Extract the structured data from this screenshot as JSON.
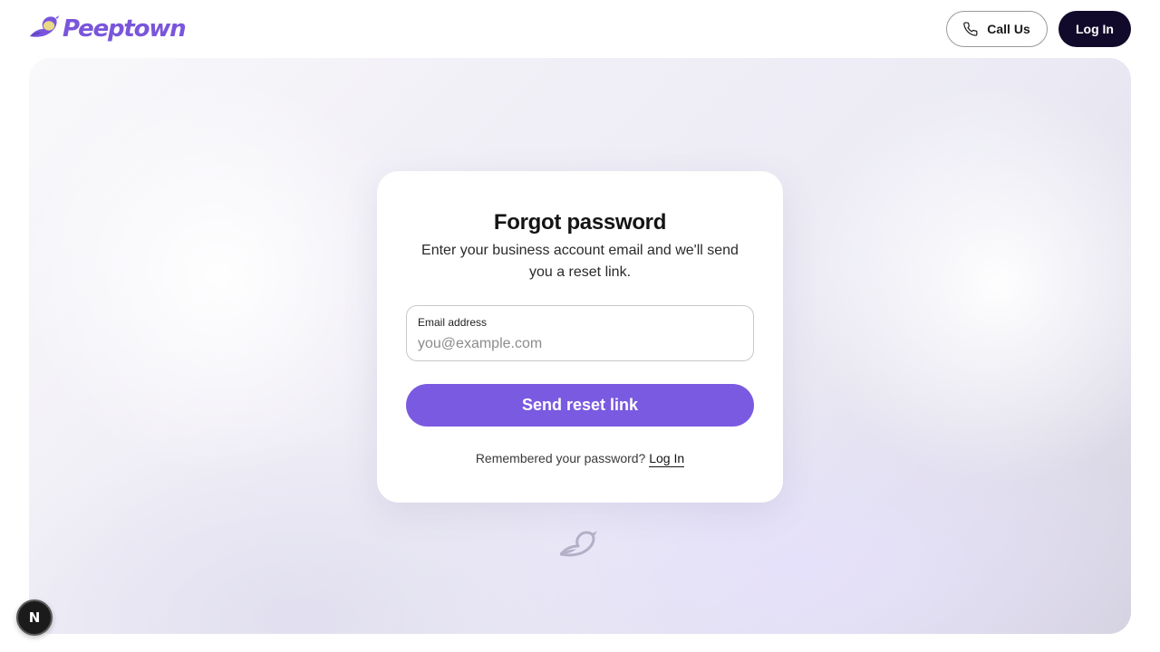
{
  "header": {
    "brand_name": "Peeptown",
    "call_label": "Call Us",
    "login_label": "Log In"
  },
  "card": {
    "title": "Forgot password",
    "subtitle": "Enter your business account email and we'll send you a reset link.",
    "email_label": "Email address",
    "email_placeholder": "you@example.com",
    "email_value": "",
    "submit_label": "Send reset link",
    "remember_text": "Remembered your password?",
    "remember_link": "Log In"
  },
  "dev_badge": {
    "label": "N"
  },
  "icons": {
    "brand": "bird-logo-icon",
    "call": "phone-icon",
    "footer": "bird-icon",
    "badge": "nextjs-icon"
  },
  "colors": {
    "brand": "#7a55dc",
    "accent_button": "#7a5ae0",
    "dark_button": "#120a2a",
    "logo_body": "#7a55dc",
    "logo_wing": "#ead985",
    "footer_bird": "#b2afc6"
  }
}
